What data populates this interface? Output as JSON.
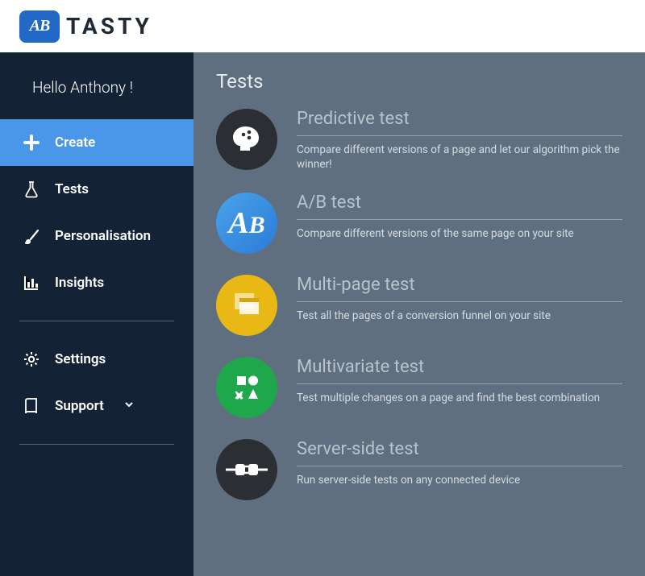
{
  "brand": {
    "badge": "AB",
    "name": "TASTY"
  },
  "sidebar": {
    "greeting": "Hello Anthony !",
    "items": [
      {
        "label": "Create",
        "icon": "plus-icon",
        "active": true
      },
      {
        "label": "Tests",
        "icon": "flask-icon",
        "active": false
      },
      {
        "label": "Personalisation",
        "icon": "brush-icon",
        "active": false
      },
      {
        "label": "Insights",
        "icon": "barchart-icon",
        "active": false
      }
    ],
    "footer": [
      {
        "label": "Settings",
        "icon": "gear-icon",
        "expandable": false
      },
      {
        "label": "Support",
        "icon": "book-icon",
        "expandable": true
      }
    ]
  },
  "main": {
    "title": "Tests",
    "tests": [
      {
        "title": "Predictive test",
        "desc": "Compare different versions of a page and let our algorithm pick the winner!",
        "icon": "brain-icon",
        "color_class": "ic-pred"
      },
      {
        "title": "A/B test",
        "desc": "Compare different versions of the same page on your site",
        "icon": "ab-icon",
        "color_class": "ic-ab"
      },
      {
        "title": "Multi-page test",
        "desc": "Test all the pages of a conversion funnel on your site",
        "icon": "pages-icon",
        "color_class": "ic-multi"
      },
      {
        "title": "Multivariate test",
        "desc": "Test multiple changes on a page and find the best combination",
        "icon": "shapes-icon",
        "color_class": "ic-mv"
      },
      {
        "title": "Server-side test",
        "desc": "Run server-side tests on any connected device",
        "icon": "plug-icon",
        "color_class": "ic-ss"
      }
    ]
  }
}
